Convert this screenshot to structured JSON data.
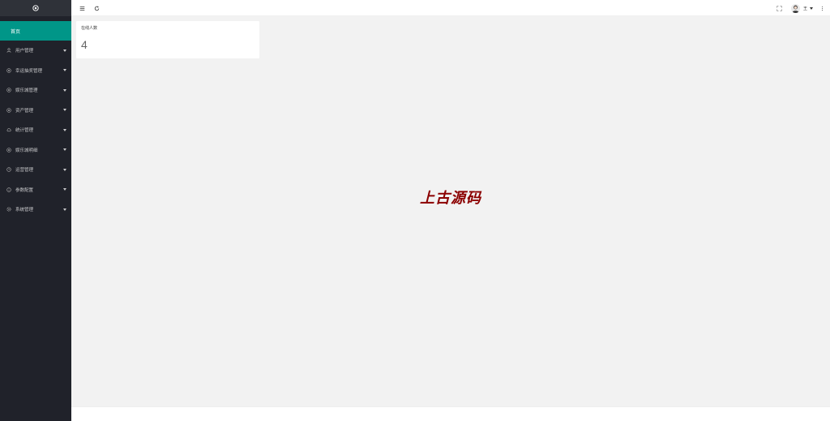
{
  "app": {
    "brand_color": "#009688",
    "sidebar_bg": "#20222a",
    "logo_icon": "gear-icon"
  },
  "sidebar": {
    "home": {
      "label": "首页"
    },
    "items": [
      {
        "label": "用户管理",
        "icon": "user-icon"
      },
      {
        "label": "幸运抽奖管理",
        "icon": "circle-dot-icon"
      },
      {
        "label": "娱乐城管理",
        "icon": "circle-dot-icon"
      },
      {
        "label": "资产管理",
        "icon": "circle-dot-icon"
      },
      {
        "label": "统计管理",
        "icon": "cloud-icon"
      },
      {
        "label": "娱乐城明细",
        "icon": "circle-dot-icon"
      },
      {
        "label": "运营管理",
        "icon": "clock-icon"
      },
      {
        "label": "参数配置",
        "icon": "info-icon"
      },
      {
        "label": "系统管理",
        "icon": "gear-icon"
      }
    ]
  },
  "header": {
    "menu_toggle_icon": "menu-icon",
    "refresh_icon": "refresh-icon",
    "fullscreen_icon": "fullscreen-icon",
    "more_icon": "more-vertical-icon",
    "user": {
      "name": "王"
    }
  },
  "dashboard": {
    "online_card": {
      "title": "在线人数",
      "value": "4"
    }
  },
  "watermark": {
    "text": "上古源码"
  }
}
